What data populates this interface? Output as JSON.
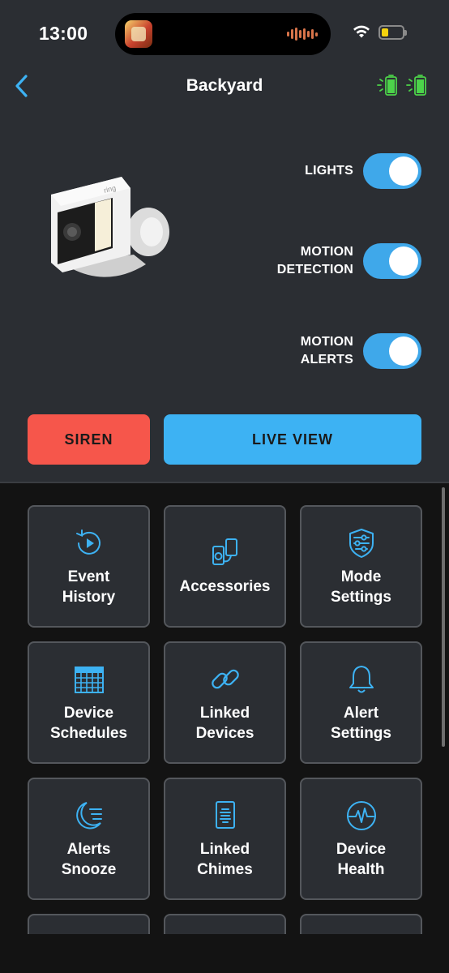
{
  "status_bar": {
    "time": "13:00"
  },
  "header": {
    "title": "Backyard"
  },
  "toggles": [
    {
      "label": "LIGHTS",
      "on": true
    },
    {
      "label": "MOTION\nDETECTION",
      "on": true
    },
    {
      "label": "MOTION\nALERTS",
      "on": true
    }
  ],
  "actions": {
    "siren_label": "SIREN",
    "live_view_label": "LIVE VIEW"
  },
  "tiles": [
    {
      "label": "Event\nHistory",
      "icon": "event-history-icon"
    },
    {
      "label": "Accessories",
      "icon": "accessories-icon"
    },
    {
      "label": "Mode\nSettings",
      "icon": "mode-settings-icon"
    },
    {
      "label": "Device\nSchedules",
      "icon": "calendar-icon"
    },
    {
      "label": "Linked\nDevices",
      "icon": "link-icon"
    },
    {
      "label": "Alert\nSettings",
      "icon": "bell-icon"
    },
    {
      "label": "Alerts\nSnooze",
      "icon": "moon-icon"
    },
    {
      "label": "Linked\nChimes",
      "icon": "chime-icon"
    },
    {
      "label": "Device\nHealth",
      "icon": "health-pulse-icon"
    }
  ],
  "colors": {
    "accent_blue": "#3db2f3",
    "siren_red": "#f6564b",
    "battery_green": "#4cd34a",
    "background": "#2b2e33"
  }
}
